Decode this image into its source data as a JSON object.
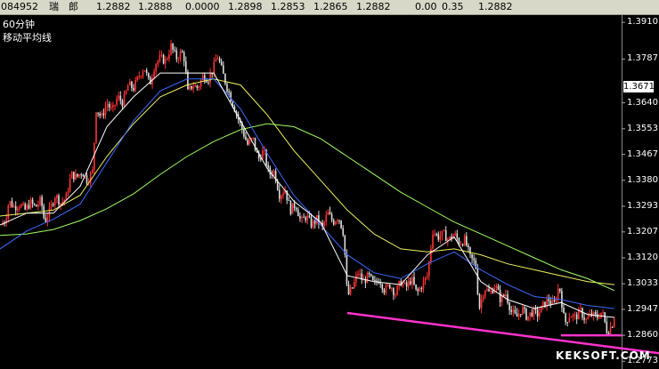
{
  "header": {
    "code_fragment": "084952",
    "name": "瑞　郎",
    "fields": [
      "1.2882",
      "1.2888",
      "0.0000",
      "1.2898",
      "1.2853",
      "1.2865",
      "1.2882",
      "0.00",
      "0.35",
      "1.2882"
    ]
  },
  "legend": {
    "period": "60分钟",
    "indicator": "移动平均线"
  },
  "current_price": "1.3671",
  "watermark": "KEKSOFT.COM",
  "colors": {
    "background": "#000000",
    "up_candle": "#ff3333",
    "down_candle": "#dddddd",
    "ma_short": "#ffffff",
    "ma_mid": "#f0f060",
    "ma_long": "#3a6bff",
    "ma_longest": "#a0ff60",
    "trendline": "#ff33cc"
  },
  "chart_data": {
    "type": "candlestick",
    "y_ticks": [
      "1.3910",
      "1.3787",
      "1.3640",
      "1.3553",
      "1.3467",
      "1.3380",
      "1.3293",
      "1.3207",
      "1.3120",
      "1.3033",
      "1.2947",
      "1.2860",
      "1.2773"
    ],
    "ylim": [
      1.2747,
      1.3985
    ],
    "close_path": [
      [
        0,
        1.323
      ],
      [
        6,
        1.3245
      ],
      [
        10,
        1.331
      ],
      [
        16,
        1.329
      ],
      [
        22,
        1.33
      ],
      [
        28,
        1.328
      ],
      [
        34,
        1.3305
      ],
      [
        40,
        1.329
      ],
      [
        46,
        1.3315
      ],
      [
        50,
        1.324
      ],
      [
        56,
        1.328
      ],
      [
        62,
        1.333
      ],
      [
        68,
        1.3305
      ],
      [
        74,
        1.332
      ],
      [
        80,
        1.34
      ],
      [
        86,
        1.339
      ],
      [
        92,
        1.341
      ],
      [
        98,
        1.338
      ],
      [
        104,
        1.341
      ],
      [
        108,
        1.362
      ],
      [
        114,
        1.359
      ],
      [
        120,
        1.364
      ],
      [
        126,
        1.361
      ],
      [
        132,
        1.366
      ],
      [
        138,
        1.364
      ],
      [
        144,
        1.37
      ],
      [
        150,
        1.369
      ],
      [
        156,
        1.373
      ],
      [
        162,
        1.376
      ],
      [
        168,
        1.37
      ],
      [
        174,
        1.377
      ],
      [
        180,
        1.379
      ],
      [
        186,
        1.378
      ],
      [
        192,
        1.383
      ],
      [
        198,
        1.379
      ],
      [
        204,
        1.381
      ],
      [
        208,
        1.378
      ],
      [
        210,
        1.367
      ],
      [
        216,
        1.37
      ],
      [
        222,
        1.369
      ],
      [
        228,
        1.373
      ],
      [
        234,
        1.372
      ],
      [
        240,
        1.376
      ],
      [
        244,
        1.38
      ],
      [
        248,
        1.376
      ],
      [
        254,
        1.37
      ],
      [
        260,
        1.365
      ],
      [
        266,
        1.36
      ],
      [
        272,
        1.355
      ],
      [
        278,
        1.35
      ],
      [
        284,
        1.352
      ],
      [
        290,
        1.345
      ],
      [
        296,
        1.348
      ],
      [
        302,
        1.34
      ],
      [
        308,
        1.341
      ],
      [
        314,
        1.333
      ],
      [
        320,
        1.335
      ],
      [
        326,
        1.328
      ],
      [
        332,
        1.33
      ],
      [
        338,
        1.324
      ],
      [
        344,
        1.326
      ],
      [
        350,
        1.323
      ],
      [
        356,
        1.325
      ],
      [
        362,
        1.322
      ],
      [
        368,
        1.327
      ],
      [
        374,
        1.324
      ],
      [
        380,
        1.326
      ],
      [
        386,
        1.32
      ],
      [
        390,
        1.299
      ],
      [
        396,
        1.302
      ],
      [
        402,
        1.307
      ],
      [
        408,
        1.304
      ],
      [
        414,
        1.306
      ],
      [
        420,
        1.303
      ],
      [
        426,
        1.305
      ],
      [
        432,
        1.301
      ],
      [
        438,
        1.303
      ],
      [
        444,
        1.3
      ],
      [
        450,
        1.304
      ],
      [
        456,
        1.302
      ],
      [
        462,
        1.305
      ],
      [
        468,
        1.3
      ],
      [
        474,
        1.303
      ],
      [
        480,
        1.306
      ],
      [
        486,
        1.321
      ],
      [
        492,
        1.319
      ],
      [
        498,
        1.32
      ],
      [
        504,
        1.318
      ],
      [
        510,
        1.32
      ],
      [
        516,
        1.317
      ],
      [
        522,
        1.318
      ],
      [
        528,
        1.312
      ],
      [
        534,
        1.31
      ],
      [
        538,
        1.295
      ],
      [
        544,
        1.302
      ],
      [
        550,
        1.3
      ],
      [
        556,
        1.303
      ],
      [
        562,
        1.298
      ],
      [
        568,
        1.3
      ],
      [
        574,
        1.294
      ],
      [
        580,
        1.292
      ],
      [
        586,
        1.295
      ],
      [
        592,
        1.292
      ],
      [
        598,
        1.294
      ],
      [
        604,
        1.293
      ],
      [
        610,
        1.296
      ],
      [
        616,
        1.298
      ],
      [
        622,
        1.296
      ],
      [
        628,
        1.303
      ],
      [
        634,
        1.29
      ],
      [
        640,
        1.293
      ],
      [
        646,
        1.292
      ],
      [
        652,
        1.294
      ],
      [
        658,
        1.291
      ],
      [
        664,
        1.293
      ],
      [
        670,
        1.292
      ],
      [
        676,
        1.294
      ],
      [
        682,
        1.287
      ],
      [
        688,
        1.29
      ],
      [
        690,
        1.293
      ]
    ],
    "moving_averages": [
      {
        "color_key": "ma_mid",
        "points": [
          [
            0,
            1.326
          ],
          [
            30,
            1.327
          ],
          [
            60,
            1.328
          ],
          [
            90,
            1.333
          ],
          [
            120,
            1.346
          ],
          [
            150,
            1.357
          ],
          [
            180,
            1.366
          ],
          [
            210,
            1.37
          ],
          [
            240,
            1.372
          ],
          [
            270,
            1.37
          ],
          [
            300,
            1.36
          ],
          [
            330,
            1.348
          ],
          [
            360,
            1.338
          ],
          [
            390,
            1.328
          ],
          [
            420,
            1.32
          ],
          [
            450,
            1.315
          ],
          [
            480,
            1.314
          ],
          [
            510,
            1.315
          ],
          [
            540,
            1.313
          ],
          [
            570,
            1.31
          ],
          [
            600,
            1.308
          ],
          [
            630,
            1.306
          ],
          [
            660,
            1.304
          ],
          [
            690,
            1.303
          ]
        ]
      },
      {
        "color_key": "ma_longest",
        "points": [
          [
            0,
            1.3195
          ],
          [
            30,
            1.32
          ],
          [
            60,
            1.3215
          ],
          [
            90,
            1.3245
          ],
          [
            120,
            1.3285
          ],
          [
            150,
            1.3335
          ],
          [
            180,
            1.34
          ],
          [
            210,
            1.346
          ],
          [
            240,
            1.351
          ],
          [
            270,
            1.355
          ],
          [
            300,
            1.357
          ],
          [
            330,
            1.356
          ],
          [
            360,
            1.352
          ],
          [
            390,
            1.346
          ],
          [
            420,
            1.34
          ],
          [
            450,
            1.334
          ],
          [
            480,
            1.329
          ],
          [
            510,
            1.324
          ],
          [
            540,
            1.32
          ],
          [
            570,
            1.316
          ],
          [
            600,
            1.312
          ],
          [
            630,
            1.308
          ],
          [
            660,
            1.305
          ],
          [
            690,
            1.301
          ]
        ]
      },
      {
        "color_key": "ma_long",
        "points": [
          [
            0,
            1.315
          ],
          [
            30,
            1.321
          ],
          [
            60,
            1.325
          ],
          [
            90,
            1.33
          ],
          [
            120,
            1.344
          ],
          [
            150,
            1.358
          ],
          [
            180,
            1.368
          ],
          [
            210,
            1.372
          ],
          [
            240,
            1.372
          ],
          [
            270,
            1.362
          ],
          [
            300,
            1.347
          ],
          [
            330,
            1.333
          ],
          [
            360,
            1.323
          ],
          [
            390,
            1.313
          ],
          [
            420,
            1.307
          ],
          [
            450,
            1.305
          ],
          [
            480,
            1.31
          ],
          [
            510,
            1.314
          ],
          [
            540,
            1.308
          ],
          [
            570,
            1.303
          ],
          [
            600,
            1.299
          ],
          [
            630,
            1.298
          ],
          [
            660,
            1.296
          ],
          [
            690,
            1.295
          ]
        ]
      },
      {
        "color_key": "ma_short",
        "points": [
          [
            0,
            1.323
          ],
          [
            30,
            1.327
          ],
          [
            60,
            1.327
          ],
          [
            90,
            1.336
          ],
          [
            120,
            1.356
          ],
          [
            150,
            1.366
          ],
          [
            180,
            1.374
          ],
          [
            210,
            1.374
          ],
          [
            240,
            1.374
          ],
          [
            270,
            1.358
          ],
          [
            300,
            1.342
          ],
          [
            330,
            1.331
          ],
          [
            360,
            1.324
          ],
          [
            390,
            1.306
          ],
          [
            420,
            1.304
          ],
          [
            450,
            1.303
          ],
          [
            480,
            1.313
          ],
          [
            510,
            1.319
          ],
          [
            540,
            1.304
          ],
          [
            570,
            1.298
          ],
          [
            600,
            1.295
          ],
          [
            630,
            1.297
          ],
          [
            660,
            1.293
          ],
          [
            690,
            1.292
          ]
        ]
      }
    ],
    "trendlines": [
      {
        "from": [
          390,
          1.2935
        ],
        "to": [
          740,
          1.28
        ]
      },
      {
        "from": [
          630,
          1.286
        ],
        "to": [
          698,
          1.286
        ]
      }
    ]
  }
}
